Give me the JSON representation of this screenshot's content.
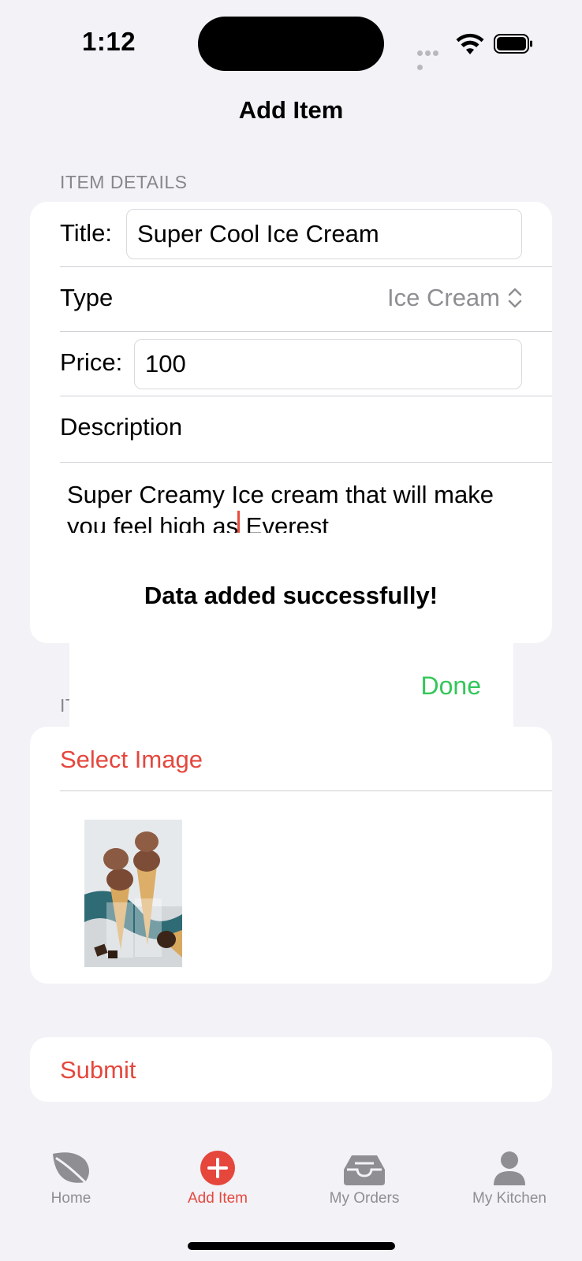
{
  "status_bar": {
    "time": "1:12"
  },
  "nav": {
    "title": "Add Item"
  },
  "item_details": {
    "header": "ITEM DETAILS",
    "title_label": "Title:",
    "title_value": "Super Cool Ice Cream",
    "type_label": "Type",
    "type_value": "Ice Cream",
    "price_label": "Price:",
    "price_value": "100",
    "description_label": "Description",
    "description_line1": "Super Creamy Ice cream that will make",
    "description_line2_before_caret": "you feel high as",
    "description_line2_after_caret": "Everest"
  },
  "image_section": {
    "header_partial": "IT",
    "select_image_label": "Select Image",
    "thumbnail_alt": "ice cream cones"
  },
  "alert": {
    "message": "Data added successfully!",
    "done_label": "Done"
  },
  "submit": {
    "label": "Submit"
  },
  "tab_bar": {
    "tabs": [
      {
        "label": "Home",
        "icon": "leaf-icon",
        "active": false
      },
      {
        "label": "Add Item",
        "icon": "plus-circle-icon",
        "active": true
      },
      {
        "label": "My Orders",
        "icon": "tray-icon",
        "active": false
      },
      {
        "label": "My Kitchen",
        "icon": "person-icon",
        "active": false
      }
    ]
  },
  "colors": {
    "accent": "#e5473d",
    "done": "#34c759",
    "background": "#f2f2f7",
    "secondary_text": "#8e8e93"
  }
}
